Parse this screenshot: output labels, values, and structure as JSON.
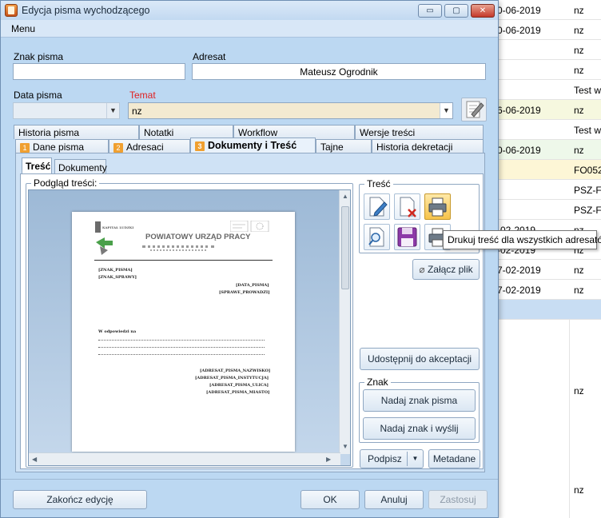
{
  "background_list": {
    "rows": [
      {
        "date": "0-06-2019",
        "col2": "nz",
        "color": "#ffffff"
      },
      {
        "date": "0-06-2019",
        "col2": "nz",
        "color": "#ffffff"
      },
      {
        "date": "",
        "col2": "nz",
        "color": "#ffffff"
      },
      {
        "date": "",
        "col2": "nz",
        "color": "#ffffff"
      },
      {
        "date": "",
        "col2": "Test w",
        "color": "#ffffff"
      },
      {
        "date": "6-06-2019",
        "col2": "nz",
        "color": "#f6f8df"
      },
      {
        "date": "",
        "col2": "Test w",
        "color": "#ffffff"
      },
      {
        "date": "0-06-2019",
        "col2": "nz",
        "color": "#eef8ea"
      },
      {
        "date": "",
        "col2": "FO052",
        "color": "#fdf6d6"
      },
      {
        "date": "",
        "col2": "PSZ-F",
        "color": "#ffffff"
      },
      {
        "date": "",
        "col2": "PSZ-F",
        "color": "#ffffff"
      },
      {
        "date": "-02-2019",
        "col2": "nz",
        "color": "#ffffff"
      },
      {
        "date": "-02-2019",
        "col2": "nz",
        "color": "#ffffff"
      },
      {
        "date": "7-02-2019",
        "col2": "nz",
        "color": "#ffffff"
      },
      {
        "date": "7-02-2019",
        "col2": "nz",
        "color": "#ffffff"
      },
      {
        "date": "",
        "col2": "",
        "color": "#c8ddf3"
      }
    ],
    "extra_1": "nz",
    "extra_2": "nz"
  },
  "window": {
    "title": "Edycja pisma wychodzącego",
    "minimize": "▭",
    "maximize": "▢",
    "close": "✕"
  },
  "menu": {
    "label": "Menu"
  },
  "form": {
    "znak_label": "Znak pisma",
    "znak_value": "",
    "adresat_label": "Adresat",
    "adresat_value": "Mateusz Ogrodnik",
    "data_label": "Data pisma",
    "data_value": "",
    "temat_label": "Temat",
    "temat_value": "nz"
  },
  "tabs_row1": [
    "Historia pisma",
    "Notatki",
    "Workflow",
    "Wersje treści"
  ],
  "tabs_row2": [
    {
      "num": "1",
      "label": "Dane pisma"
    },
    {
      "num": "2",
      "label": "Adresaci"
    },
    {
      "num": "3",
      "label": "Dokumenty i Treść"
    },
    {
      "num": "",
      "label": "Tajne"
    },
    {
      "num": "",
      "label": "Historia dekretacji"
    }
  ],
  "subtabs": [
    "Treść",
    "Dokumenty"
  ],
  "preview": {
    "group_title": "Podgląd treści:",
    "doc": {
      "logo_text": "KAPITAŁ LUDZKI",
      "heading": "POWIATOWY URZĄD PRACY",
      "f_znak": "[ZNAK_PISMA]",
      "f_sprawy": "[ZNAK_SPRAWY]",
      "f_data": "[DATA_PISMA]",
      "f_prowadzi": "[SPRAWE_PROWADZI]",
      "f_odp": "W odpowiedzi na",
      "f_nazwisko": "[ADRESAT_PISMA_NAZWISKO]",
      "f_instytucja": "[ADRESAT_PISMA_INSTYTUCJA]",
      "f_ulica": "[ADRESAT_PISMA_ULICA]",
      "f_miasto": "[ADRESAT_PISMA_MIASTO]"
    }
  },
  "tresc_group": {
    "title": "Treść",
    "tooltip": "Drukuj treść dla wszystkich adresatów"
  },
  "buttons": {
    "attach": "Załącz plik",
    "share": "Udostępnij do akceptacji",
    "znak_group": "Znak",
    "nadaj": "Nadaj znak pisma",
    "nadaj_wyslij": "Nadaj znak i wyślij",
    "podpisz": "Podpisz",
    "metadane": "Metadane",
    "zakoncz": "Zakończ edycję",
    "ok": "OK",
    "anuluj": "Anuluj",
    "zastosuj": "Zastosuj"
  }
}
